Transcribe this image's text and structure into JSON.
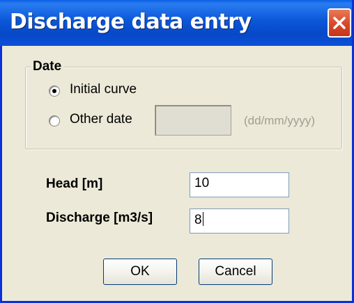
{
  "window": {
    "title": "Discharge data entry",
    "close_icon": "close-icon"
  },
  "date_group": {
    "title": "Date",
    "options": [
      {
        "label": "Initial curve",
        "selected": true
      },
      {
        "label": "Other date",
        "selected": false
      }
    ],
    "date_value": "",
    "date_format_hint": "(dd/mm/yyyy)"
  },
  "fields": {
    "head": {
      "label": "Head [m]",
      "value": "10"
    },
    "discharge": {
      "label": "Discharge [m3/s]",
      "value": "8"
    }
  },
  "buttons": {
    "ok": "OK",
    "cancel": "Cancel"
  },
  "colors": {
    "titlebar": "#0b57d8",
    "close_button": "#d9472a",
    "dialog_background": "#ece9d8"
  }
}
